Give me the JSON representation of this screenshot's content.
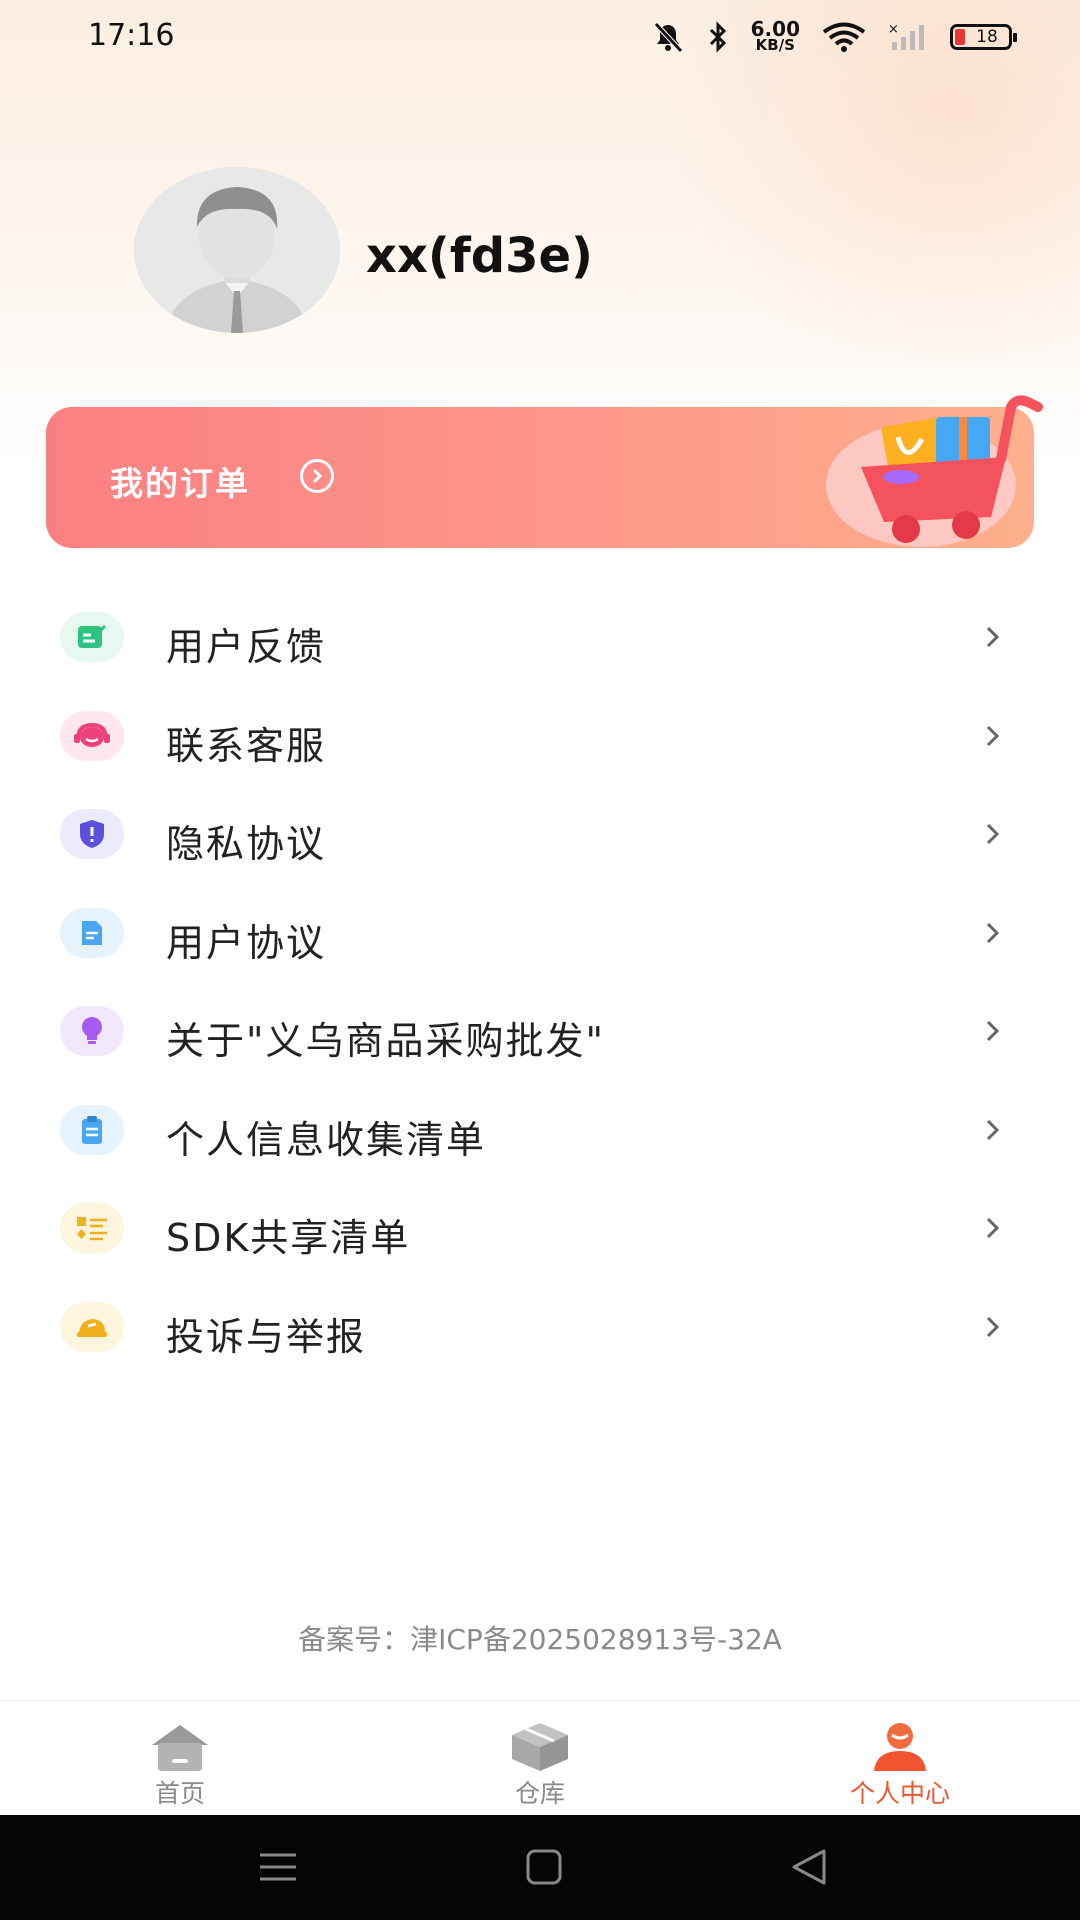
{
  "status_bar": {
    "time": "17:16",
    "net_speed_value": "6.00",
    "net_speed_unit": "KB/S",
    "battery": "18"
  },
  "profile": {
    "username": "xx(fd3e)"
  },
  "orders": {
    "label": "我的订单"
  },
  "menu": {
    "items": [
      {
        "label": "用户反馈",
        "icon": "feedback-icon",
        "color": "#2ec27e",
        "bg": "#e6f8ef"
      },
      {
        "label": "联系客服",
        "icon": "headset-icon",
        "color": "#f0407a",
        "bg": "#fde7ee"
      },
      {
        "label": "隐私协议",
        "icon": "shield-icon",
        "color": "#5b4fe0",
        "bg": "#ecebfb"
      },
      {
        "label": "用户协议",
        "icon": "document-icon",
        "color": "#4aa6f0",
        "bg": "#e6f2fc"
      },
      {
        "label": "关于\"义乌商品采购批发\"",
        "icon": "lightbulb-icon",
        "color": "#a65cf0",
        "bg": "#f2e8fd"
      },
      {
        "label": "个人信息收集清单",
        "icon": "clipboard-icon",
        "color": "#4aa6f0",
        "bg": "#e6f2fc"
      },
      {
        "label": "SDK共享清单",
        "icon": "list-icon",
        "color": "#f2b01e",
        "bg": "#fdf5dd"
      },
      {
        "label": "投诉与举报",
        "icon": "report-icon",
        "color": "#f2b01e",
        "bg": "#fdf5dd"
      }
    ]
  },
  "filing": {
    "text": "备案号：津ICP备2025028913号-32A"
  },
  "tabs": [
    {
      "label": "首页",
      "icon": "home-icon"
    },
    {
      "label": "仓库",
      "icon": "box-icon"
    },
    {
      "label": "个人中心",
      "icon": "person-icon"
    }
  ],
  "colors": {
    "accent": "#f0552f",
    "banner_start": "#fb7f82",
    "banner_end": "#ffb08c"
  }
}
